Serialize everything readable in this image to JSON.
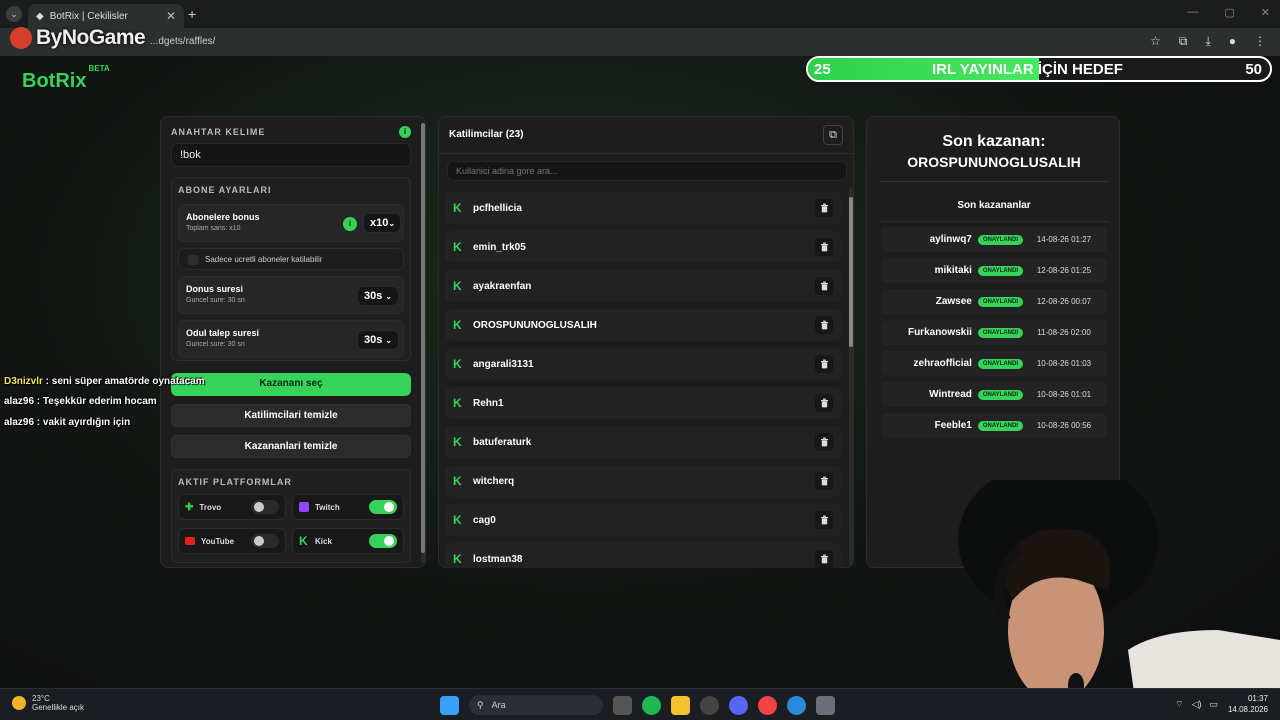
{
  "browser": {
    "tab_title": "BotRix | Cekilisler",
    "url": "...dgets/raffles/",
    "overlay_logo": "ByNoGame"
  },
  "app": {
    "brand": "BotRix",
    "brand_tag": "BETA",
    "accent": "#35d35a"
  },
  "goal": {
    "current": "25",
    "title": "IRL YAYINLAR İÇİN HEDEF",
    "target": "50",
    "progress": 0.5
  },
  "settings": {
    "keyword_label": "ANAHTAR KELIME",
    "keyword_value": "!bok",
    "sub_settings_label": "ABONE AYARLARI",
    "sub_bonus_title": "Abonelere bonus",
    "sub_bonus_sub": "Toplam sans: x10",
    "sub_bonus_value": "x10",
    "sub_only_label": "Sadece ucretli aboneler katilabilir",
    "spin_title": "Donus suresi",
    "spin_sub": "Guncel sure: 30 sn",
    "spin_value": "30s",
    "claim_title": "Odul talep suresi",
    "claim_sub": "Guncel sure: 30 sn",
    "claim_value": "30s",
    "pick_winner": "Kazananı seç",
    "clear_participants": "Katilimcilari temizle",
    "clear_winners": "Kazananlari temizle",
    "platforms_label": "AKTIF PLATFORMLAR",
    "platforms": [
      {
        "name": "Trovo",
        "on": false
      },
      {
        "name": "Twitch",
        "on": true
      },
      {
        "name": "YouTube",
        "on": false
      },
      {
        "name": "Kick",
        "on": true
      }
    ]
  },
  "participants": {
    "title": "Katilimcilar (23)",
    "search_placeholder": "Kullanici adina gore ara...",
    "items": [
      "pcfhellicia",
      "emin_trk05",
      "ayakraenfan",
      "OROSPUNUNOGLUSALIH",
      "angarali3131",
      "Rehn1",
      "batuferaturk",
      "witcherq",
      "cag0",
      "lostman38"
    ]
  },
  "winners": {
    "last_label": "Son kazanan:",
    "last_name": "OROSPUNUNOGLUSALIH",
    "list_title": "Son kazananlar",
    "badge": "ONAYLANDI",
    "items": [
      {
        "name": "aylinwq7",
        "date": "14-08-26 01:27"
      },
      {
        "name": "mikitaki",
        "date": "12-08-26 01:25"
      },
      {
        "name": "Zawsee",
        "date": "12-08-26 00:07"
      },
      {
        "name": "Furkanowskii",
        "date": "11-08-26 02:00"
      },
      {
        "name": "zehraofficial",
        "date": "10-08-26 01:03"
      },
      {
        "name": "Wintread",
        "date": "10-08-26 01:01"
      },
      {
        "name": "Feeble1",
        "date": "10-08-26 00:56"
      }
    ]
  },
  "chat": [
    {
      "user": "D3nizvlr",
      "msg": "seni süper amatörde oynatacam"
    },
    {
      "user": "alaz96",
      "msg": "Teşekkür ederim hocam"
    },
    {
      "user": "alaz96",
      "msg": "vakit ayırdığın için"
    }
  ],
  "taskbar": {
    "temp": "23°C",
    "weather": "Genellikle açık",
    "search": "Ara",
    "time": "01:37",
    "date": "14.08.2026"
  }
}
